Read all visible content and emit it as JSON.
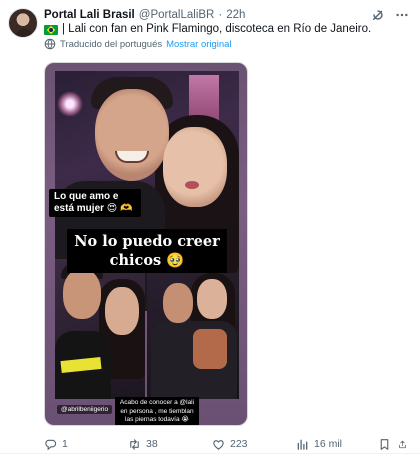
{
  "post": {
    "author_name": "Portal Lali Brasil",
    "author_handle": "@PortalLaliBR",
    "separator": "·",
    "time": "22h",
    "text": "| Lali con fan en Pink Flamingo, discoteca en Río de Janeiro.",
    "translated_note": "Traducido del portugués",
    "show_original_label": "Mostrar original"
  },
  "media": {
    "caption_love": "Lo que amo e está mujer 😍 🫶",
    "caption_main": "No lo puedo creer chicos 🥹",
    "ig_tag": "@abrilbeniigerio",
    "caption_small": "Acabo de conocer a @lali en persona , me tiemblan las piernas todavía 😭"
  },
  "actions": {
    "replies": "1",
    "reposts": "38",
    "likes": "223",
    "views": "16 mil"
  },
  "icons": {
    "header": [
      "grok-icon",
      "more-icon"
    ],
    "actions": [
      "reply-icon",
      "repost-icon",
      "like-icon",
      "views-icon",
      "bookmark-icon",
      "share-icon"
    ]
  },
  "colors": {
    "link": "#1d9bf0",
    "secondary_text": "#536471",
    "primary_text": "#0f1419",
    "media_frame": "#7a5e82"
  }
}
